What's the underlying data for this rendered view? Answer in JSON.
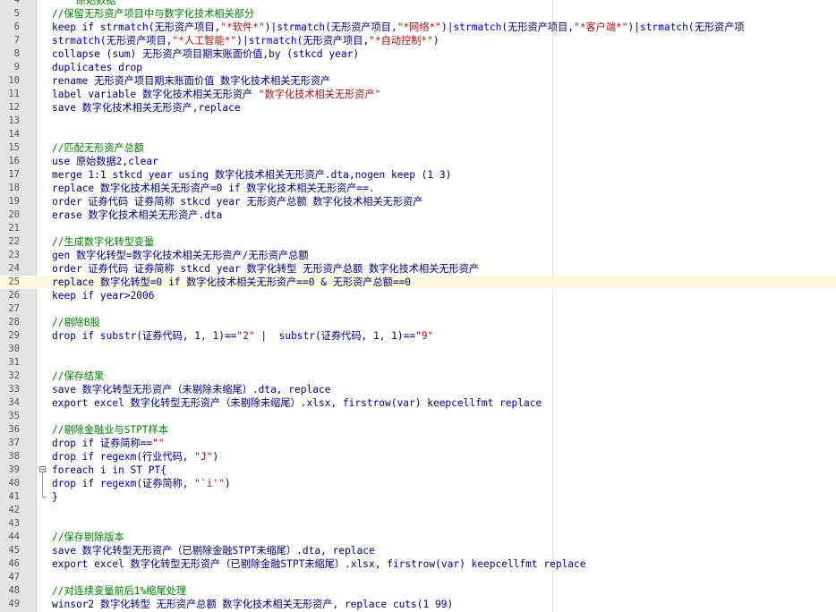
{
  "editor": {
    "lines": [
      {
        "num": "4",
        "segs": [
          {
            "c": "cm",
            "t": "    原始数据"
          }
        ]
      },
      {
        "num": "5",
        "segs": [
          {
            "c": "cm",
            "t": "//保留无形资产项目中与数字化技术相关部分"
          }
        ]
      },
      {
        "num": "6",
        "segs": [
          {
            "c": "kw",
            "t": "keep if "
          },
          {
            "c": "fn",
            "t": "strmatch"
          },
          {
            "c": "",
            "t": "(无形资产项目,"
          },
          {
            "c": "st",
            "t": "\"*软件*\""
          },
          {
            "c": "",
            "t": ")|"
          },
          {
            "c": "fn",
            "t": "strmatch"
          },
          {
            "c": "",
            "t": "(无形资产项目,"
          },
          {
            "c": "st",
            "t": "\"*网络*\""
          },
          {
            "c": "",
            "t": ")|"
          },
          {
            "c": "fn",
            "t": "strmatch"
          },
          {
            "c": "",
            "t": "(无形资产项目,"
          },
          {
            "c": "st",
            "t": "\"*客户端*\""
          },
          {
            "c": "",
            "t": ")|"
          },
          {
            "c": "fn",
            "t": "strmatch"
          },
          {
            "c": "",
            "t": "(无形资产项"
          }
        ]
      },
      {
        "num": "7",
        "segs": [
          {
            "c": "fn",
            "t": "strmatch"
          },
          {
            "c": "",
            "t": "(无形资产项目,"
          },
          {
            "c": "st",
            "t": "\"*人工智能*\""
          },
          {
            "c": "",
            "t": ")|"
          },
          {
            "c": "fn",
            "t": "strmatch"
          },
          {
            "c": "",
            "t": "(无形资产项目,"
          },
          {
            "c": "st",
            "t": "\"*自动控制*\""
          },
          {
            "c": "",
            "t": ")"
          }
        ]
      },
      {
        "num": "8",
        "segs": [
          {
            "c": "",
            "t": "collapse (sum) 无形资产项目期末账面价值,by (stkcd year)"
          }
        ]
      },
      {
        "num": "9",
        "segs": [
          {
            "c": "",
            "t": "duplicates drop"
          }
        ]
      },
      {
        "num": "10",
        "segs": [
          {
            "c": "",
            "t": "rename 无形资产项目期末账面价值 数字化技术相关无形资产"
          }
        ]
      },
      {
        "num": "11",
        "segs": [
          {
            "c": "",
            "t": "label variable 数字化技术相关无形资产 "
          },
          {
            "c": "st",
            "t": "\"数字化技术相关无形资产\""
          }
        ]
      },
      {
        "num": "12",
        "segs": [
          {
            "c": "",
            "t": "save 数字化技术相关无形资产,replace"
          }
        ]
      },
      {
        "num": "13",
        "segs": []
      },
      {
        "num": "14",
        "segs": []
      },
      {
        "num": "15",
        "segs": [
          {
            "c": "cm",
            "t": "//匹配无形资产总额"
          }
        ]
      },
      {
        "num": "16",
        "segs": [
          {
            "c": "",
            "t": "use 原始数据2,clear"
          }
        ]
      },
      {
        "num": "17",
        "segs": [
          {
            "c": "",
            "t": "merge 1:1 stkcd year using 数字化技术相关无形资产.dta,nogen keep (1 3)"
          }
        ]
      },
      {
        "num": "18",
        "segs": [
          {
            "c": "",
            "t": "replace 数字化技术相关无形资产=0 if 数字化技术相关无形资产==."
          }
        ]
      },
      {
        "num": "19",
        "segs": [
          {
            "c": "",
            "t": "order 证券代码 证券简称 stkcd year 无形资产总额 数字化技术相关无形资产"
          }
        ]
      },
      {
        "num": "20",
        "segs": [
          {
            "c": "",
            "t": "erase 数字化技术相关无形资产.dta"
          }
        ]
      },
      {
        "num": "21",
        "segs": []
      },
      {
        "num": "22",
        "segs": [
          {
            "c": "cm",
            "t": "//生成数字化转型变量"
          }
        ]
      },
      {
        "num": "23",
        "segs": [
          {
            "c": "",
            "t": "gen 数字化转型=数字化技术相关无形资产/无形资产总额"
          }
        ]
      },
      {
        "num": "24",
        "segs": [
          {
            "c": "",
            "t": "order 证券代码 证券简称 stkcd year 数字化转型 无形资产总额 数字化技术相关无形资产"
          }
        ]
      },
      {
        "num": "25",
        "segs": [
          {
            "c": "",
            "t": "replace 数字化转型=0 if 数字化技术相关无形资产==0 & 无形资产总额==0"
          }
        ],
        "current": true
      },
      {
        "num": "26",
        "segs": [
          {
            "c": "kw",
            "t": "keep if "
          },
          {
            "c": "",
            "t": "year>2006"
          }
        ]
      },
      {
        "num": "27",
        "segs": []
      },
      {
        "num": "28",
        "segs": [
          {
            "c": "cm",
            "t": "//剔除B股"
          }
        ]
      },
      {
        "num": "29",
        "segs": [
          {
            "c": "kw",
            "t": "drop if "
          },
          {
            "c": "fn",
            "t": "substr"
          },
          {
            "c": "",
            "t": "(证券代码, 1, 1)=="
          },
          {
            "c": "st",
            "t": "\"2\""
          },
          {
            "c": "",
            "t": " |  "
          },
          {
            "c": "fn",
            "t": "substr"
          },
          {
            "c": "",
            "t": "(证券代码, 1, 1)=="
          },
          {
            "c": "st",
            "t": "\"9\""
          }
        ]
      },
      {
        "num": "30",
        "segs": []
      },
      {
        "num": "31",
        "segs": []
      },
      {
        "num": "32",
        "segs": [
          {
            "c": "cm",
            "t": "//保存结果"
          }
        ]
      },
      {
        "num": "33",
        "segs": [
          {
            "c": "",
            "t": "save 数字化转型无形资产（未剔除未缩尾）.dta, "
          },
          {
            "c": "kw",
            "t": "replace"
          }
        ]
      },
      {
        "num": "34",
        "segs": [
          {
            "c": "",
            "t": "export excel 数字化转型无形资产（未剔除未缩尾）.xlsx, firstrow("
          },
          {
            "c": "kw",
            "t": "var"
          },
          {
            "c": "",
            "t": ") keepcellfmt "
          },
          {
            "c": "kw",
            "t": "replace"
          }
        ]
      },
      {
        "num": "35",
        "segs": []
      },
      {
        "num": "36",
        "segs": [
          {
            "c": "cm",
            "t": "//剔除金融业与STPT样本"
          }
        ]
      },
      {
        "num": "37",
        "segs": [
          {
            "c": "kw",
            "t": "drop if "
          },
          {
            "c": "",
            "t": "证券简称=="
          },
          {
            "c": "st",
            "t": "\"\""
          }
        ]
      },
      {
        "num": "38",
        "segs": [
          {
            "c": "kw",
            "t": "drop if "
          },
          {
            "c": "fn",
            "t": "regexm"
          },
          {
            "c": "",
            "t": "(行业代码, "
          },
          {
            "c": "st",
            "t": "\"J\""
          },
          {
            "c": "",
            "t": ")"
          }
        ]
      },
      {
        "num": "39",
        "segs": [
          {
            "c": "kw",
            "t": "foreach "
          },
          {
            "c": "",
            "t": "i in ST PT{"
          }
        ],
        "fold": "start"
      },
      {
        "num": "40",
        "segs": [
          {
            "c": "kw",
            "t": "drop if "
          },
          {
            "c": "fn",
            "t": "regexm"
          },
          {
            "c": "",
            "t": "(证券简称, "
          },
          {
            "c": "st",
            "t": "\"`i'\""
          },
          {
            "c": "",
            "t": ")"
          }
        ],
        "fold": "mid"
      },
      {
        "num": "41",
        "segs": [
          {
            "c": "",
            "t": "}"
          }
        ],
        "fold": "end"
      },
      {
        "num": "42",
        "segs": []
      },
      {
        "num": "43",
        "segs": []
      },
      {
        "num": "44",
        "segs": [
          {
            "c": "cm",
            "t": "//保存剔除版本"
          }
        ]
      },
      {
        "num": "45",
        "segs": [
          {
            "c": "",
            "t": "save 数字化转型无形资产（已剔除金融STPT未缩尾）.dta, "
          },
          {
            "c": "kw",
            "t": "replace"
          }
        ]
      },
      {
        "num": "46",
        "segs": [
          {
            "c": "",
            "t": "export excel 数字化转型无形资产（已剔除金融STPT未缩尾）.xlsx, firstrow("
          },
          {
            "c": "kw",
            "t": "var"
          },
          {
            "c": "",
            "t": ") keepcellfmt "
          },
          {
            "c": "kw",
            "t": "replace"
          }
        ]
      },
      {
        "num": "47",
        "segs": []
      },
      {
        "num": "48",
        "segs": [
          {
            "c": "cm",
            "t": "//对连续变量前后1%缩尾处理"
          }
        ]
      },
      {
        "num": "49",
        "segs": [
          {
            "c": "",
            "t": "winsor2 数字化转型 无形资产总额 数字化技术相关无形资产, replace cuts(1 99)"
          }
        ]
      }
    ]
  }
}
